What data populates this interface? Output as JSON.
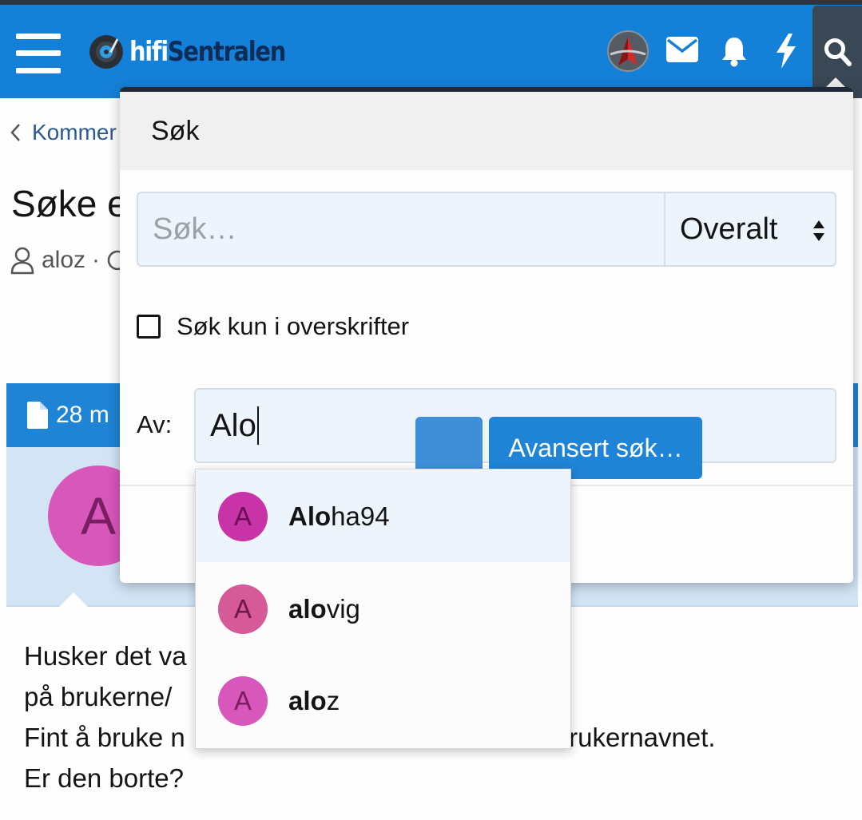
{
  "header": {
    "logo": {
      "hifi": "hifi",
      "sentralen": "Sentralen"
    },
    "icons": [
      "menu-icon",
      "avatar",
      "envelope-icon",
      "bell-icon",
      "bolt-icon",
      "search-icon"
    ]
  },
  "page": {
    "breadcrumb": "Kommer",
    "title": "Søke e",
    "meta_author": "aloz",
    "meta_sep": "·",
    "post_header": "28 m",
    "avatar_letter": "A",
    "body": {
      "line1": "Husker det va",
      "line2": "på brukerne/",
      "line3a": "Fint å bruke n",
      "line3b": "brukernavnet.",
      "line4": "Er den borte?"
    }
  },
  "search_popup": {
    "title": "Søk",
    "search_placeholder": "Søk…",
    "scope_value": "Overalt",
    "titles_only_label": "Søk kun i overskrifter",
    "by_label": "Av:",
    "by_value": "Alo",
    "advanced_button": "Avansert søk…"
  },
  "autocomplete": {
    "items": [
      {
        "letter": "A",
        "match": "Alo",
        "rest": "ha94",
        "color": "#c933a8",
        "letter_color": "#6a0d54"
      },
      {
        "letter": "A",
        "match": "alo",
        "rest": "vig",
        "color": "#d65a98",
        "letter_color": "#6e1844"
      },
      {
        "letter": "A",
        "match": "alo",
        "rest": "z",
        "color": "#d857bb",
        "letter_color": "#7a1e64"
      }
    ]
  },
  "colors": {
    "header": "#1580d8",
    "button": "#1f84d6",
    "input_bg": "#edf4fc"
  }
}
